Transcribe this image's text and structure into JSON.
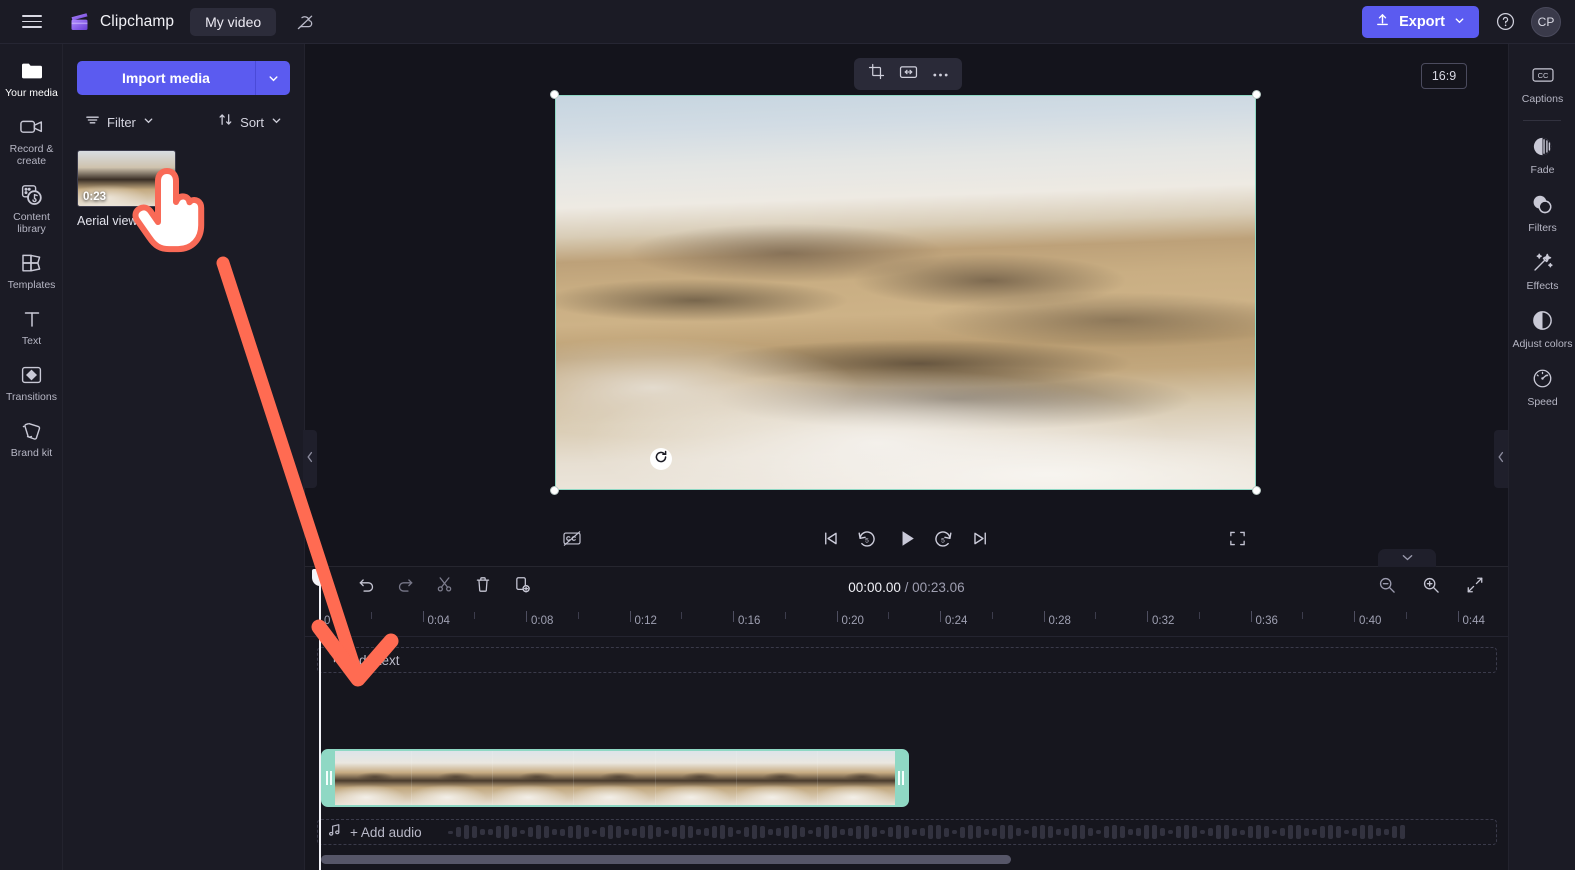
{
  "app": {
    "brand": "Clipchamp",
    "project_name": "My video",
    "menu_icon": "hamburger-icon",
    "cloud_icon": "cloud-off-icon"
  },
  "topbar": {
    "export_label": "Export",
    "export_icon": "upload-icon",
    "export_caret": "chevron-down-icon",
    "help_icon": "help-circle-icon",
    "avatar_initials": "CP",
    "accent_color": "#5b5bf0"
  },
  "left_rail": {
    "items": [
      {
        "label": "Your media",
        "icon": "folder-icon",
        "active": true
      },
      {
        "label": "Record & create",
        "icon": "video-camera-icon",
        "active": false
      },
      {
        "label": "Content library",
        "icon": "content-library-icon",
        "active": false
      },
      {
        "label": "Templates",
        "icon": "templates-icon",
        "active": false
      },
      {
        "label": "Text",
        "icon": "text-t-icon",
        "active": false
      },
      {
        "label": "Transitions",
        "icon": "transitions-icon",
        "active": false
      },
      {
        "label": "Brand kit",
        "icon": "brand-kit-icon",
        "active": false
      }
    ]
  },
  "media_panel": {
    "import_label": "Import media",
    "import_caret_icon": "chevron-down-icon",
    "filter_label": "Filter",
    "filter_icon": "filter-icon",
    "sort_label": "Sort",
    "sort_icon": "sort-arrows-icon",
    "items": [
      {
        "title": "Aerial view of",
        "duration": "0:23"
      }
    ]
  },
  "canvas": {
    "float_toolbar": [
      {
        "icon": "crop-icon",
        "name": "crop-button"
      },
      {
        "icon": "fit-width-icon",
        "name": "fit-button"
      },
      {
        "icon": "more-horizontal-icon",
        "name": "more-options-button"
      }
    ],
    "aspect_ratio": "16:9",
    "rotate_icon": "rotate-icon",
    "selection_color": "#8fd8c4"
  },
  "playback": {
    "captions_off_icon": "captions-off-icon",
    "skip_start_icon": "skip-to-start-icon",
    "rewind_icon": "rewind-5-icon",
    "play_icon": "play-icon",
    "forward_icon": "forward-5-icon",
    "skip_end_icon": "skip-to-end-icon",
    "fullscreen_icon": "fullscreen-icon"
  },
  "right_rail": {
    "items": [
      {
        "label": "Captions",
        "icon": "cc-icon"
      },
      {
        "label": "Fade",
        "icon": "fade-icon"
      },
      {
        "label": "Filters",
        "icon": "filters-icon"
      },
      {
        "label": "Effects",
        "icon": "effects-wand-icon"
      },
      {
        "label": "Adjust colors",
        "icon": "adjust-colors-icon"
      },
      {
        "label": "Speed",
        "icon": "speed-gauge-icon"
      }
    ]
  },
  "timeline": {
    "tools": [
      {
        "icon": "undo-icon",
        "name": "undo-button"
      },
      {
        "icon": "redo-icon",
        "name": "redo-button"
      },
      {
        "icon": "split-scissors-icon",
        "name": "split-button"
      },
      {
        "icon": "trash-icon",
        "name": "delete-button"
      },
      {
        "icon": "duplicate-icon",
        "name": "duplicate-button"
      }
    ],
    "current_time": "00:00.00",
    "separator": "/",
    "total_time": "00:23.06",
    "zoom_out_icon": "zoom-out-icon",
    "zoom_in_icon": "zoom-in-icon",
    "fit_timeline_icon": "fit-to-screen-icon",
    "collapse_icon": "chevron-down-icon",
    "ruler_ticks": [
      "0",
      "0:04",
      "0:08",
      "0:12",
      "0:16",
      "0:20",
      "0:24",
      "0:28",
      "0:32",
      "0:36",
      "0:40",
      "0:44"
    ],
    "text_track_label": "Add text",
    "text_track_icon": "text-t-icon",
    "audio_track_label": "+ Add audio",
    "audio_track_icon": "music-note-icon",
    "clip": {
      "selected": true,
      "frame_count": 7
    }
  },
  "collapse": {
    "left_icon": "chevron-left-icon",
    "right_icon": "chevron-left-icon"
  },
  "annotation": {
    "arrow_color": "#ff6b52",
    "cursor_icon": "pointing-hand-cursor",
    "arrow_name": "instruction-arrow"
  }
}
